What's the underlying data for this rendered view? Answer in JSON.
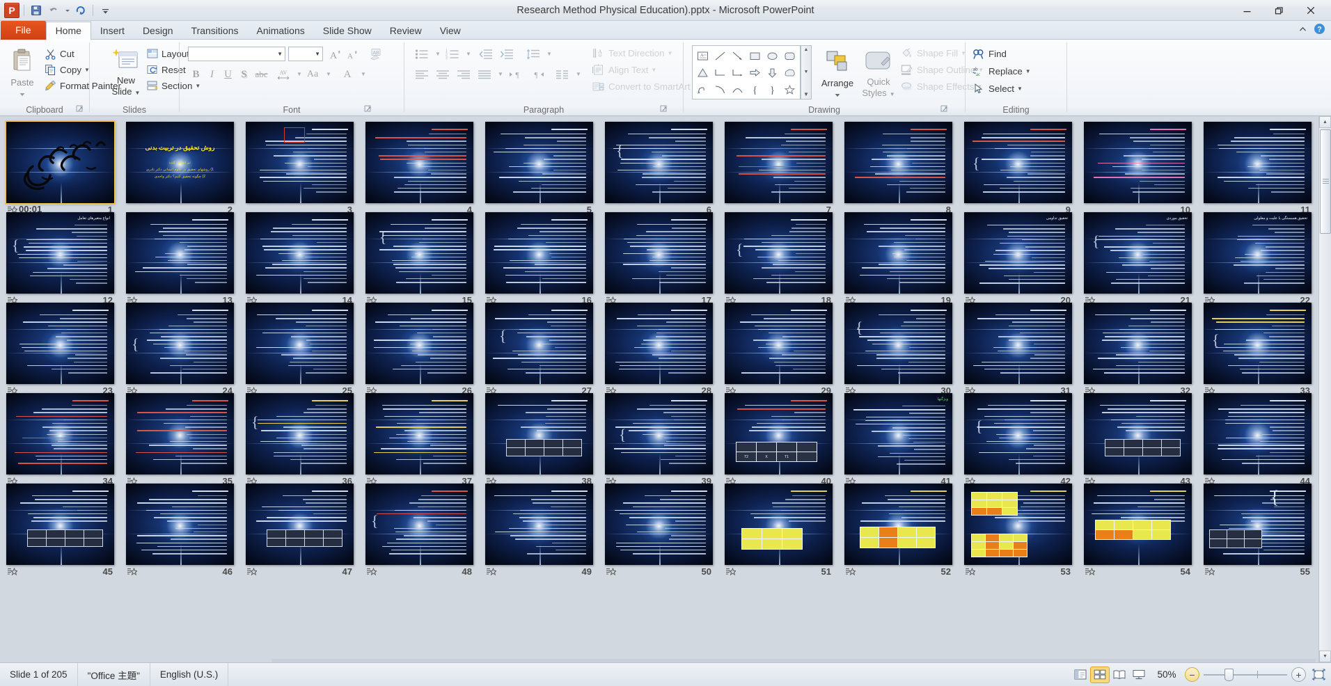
{
  "window": {
    "title": "Research Method Physical Education).pptx  -  Microsoft PowerPoint",
    "minimize_label": "—",
    "restore_label": "❐",
    "close_label": "✕"
  },
  "qat": {
    "app_icon": "powerpoint-icon",
    "app_letter": "P",
    "items": [
      {
        "name": "save-icon",
        "tip": "Save"
      },
      {
        "name": "undo-icon",
        "tip": "Undo"
      },
      {
        "name": "undo-dropdown-icon",
        "tip": "Undo History"
      },
      {
        "name": "redo-icon",
        "tip": "Redo"
      },
      {
        "name": "customize-qat-icon",
        "tip": "Customize Quick Access Toolbar"
      }
    ]
  },
  "tabs": [
    {
      "label": "File",
      "kind": "file"
    },
    {
      "label": "Home",
      "kind": "active"
    },
    {
      "label": "Insert",
      "kind": "normal"
    },
    {
      "label": "Design",
      "kind": "normal"
    },
    {
      "label": "Transitions",
      "kind": "normal"
    },
    {
      "label": "Animations",
      "kind": "normal"
    },
    {
      "label": "Slide Show",
      "kind": "normal"
    },
    {
      "label": "Review",
      "kind": "normal"
    },
    {
      "label": "View",
      "kind": "normal"
    }
  ],
  "help": {
    "minimize_ribbon": "collapse-ribbon-icon",
    "help": "help-icon",
    "help_glyph": "?"
  },
  "ribbon": {
    "groups": [
      {
        "label": "Clipboard"
      },
      {
        "label": "Slides"
      },
      {
        "label": "Font"
      },
      {
        "label": "Paragraph"
      },
      {
        "label": "Drawing"
      },
      {
        "label": "Editing"
      }
    ],
    "clipboard": {
      "paste_label": "Paste",
      "cut_label": "Cut",
      "copy_label": "Copy",
      "format_painter_label": "Format Painter"
    },
    "slides": {
      "new_slide_line1": "New",
      "new_slide_line2": "Slide",
      "layout_label": "Layout",
      "reset_label": "Reset",
      "section_label": "Section"
    },
    "font": {
      "font_name_value": "",
      "font_size_value": "",
      "grow_font": "grow-font-icon",
      "shrink_font": "shrink-font-icon",
      "clear_formatting": "clear-formatting-icon",
      "bold": "B",
      "italic": "I",
      "underline": "U",
      "shadow": "S",
      "strikethrough": "abc",
      "character_spacing": "AV",
      "change_case": "Aa",
      "font_color": "A"
    },
    "paragraph": {
      "bullets": "bullets-icon",
      "numbering": "numbering-icon",
      "decrease_indent": "decrease-indent-icon",
      "increase_indent": "increase-indent-icon",
      "line_spacing": "line-spacing-icon",
      "align_left": "align-left-icon",
      "align_center": "align-center-icon",
      "align_right": "align-right-icon",
      "justify": "justify-icon",
      "ltr": "left-to-right-icon",
      "rtl": "right-to-left-icon",
      "columns": "columns-icon",
      "text_direction_label": "Text Direction",
      "align_text_label": "Align Text",
      "convert_smartart_label": "Convert to SmartArt"
    },
    "drawing": {
      "arrange_label": "Arrange",
      "quick_styles_line1": "Quick",
      "quick_styles_line2": "Styles",
      "shape_fill_label": "Shape Fill",
      "shape_outline_label": "Shape Outline",
      "shape_effects_label": "Shape Effects",
      "shapes": [
        "textbox-shape-icon",
        "line-shape-icon",
        "arrow-shape-icon",
        "rectangle-shape-icon",
        "oval-shape-icon",
        "rounded-rectangle-shape-icon",
        "triangle-shape-icon",
        "elbow-connector-icon",
        "elbow-arrow-connector-icon",
        "right-arrow-shape-icon",
        "down-arrow-shape-icon",
        "cloud-shape-icon",
        "freeform-shape-icon",
        "curve-shape-icon",
        "arc-shape-icon",
        "left-brace-shape-icon",
        "right-brace-shape-icon",
        "star-shape-icon"
      ]
    },
    "editing": {
      "find_label": "Find",
      "replace_label": "Replace",
      "select_label": "Select"
    }
  },
  "sorter": {
    "columns": 11,
    "selected_slide": 1,
    "slides": [
      {
        "n": 1,
        "kind": "bismillah",
        "transition": "00:01",
        "title": "",
        "bullets": []
      },
      {
        "n": 2,
        "kind": "title",
        "transition": "",
        "title": "روش تحقیق در تربیت بدنی",
        "bullets": [
          ":بر اساس کتب",
          "1) روشهای تحقیق در علوم انسانی    دکتر نادری",
          "2)   چگونه تحقیق کنیم؟        دکتر واحدی"
        ]
      },
      {
        "n": 3,
        "kind": "figure-box",
        "transition": "",
        "title": "",
        "bullets": []
      },
      {
        "n": 4,
        "kind": "text-red",
        "transition": "",
        "title": "",
        "bullets": []
      },
      {
        "n": 5,
        "kind": "text",
        "transition": "",
        "title": "",
        "bullets": []
      },
      {
        "n": 6,
        "kind": "text",
        "transition": "",
        "title": "",
        "bullets": []
      },
      {
        "n": 7,
        "kind": "text-red",
        "transition": "",
        "title": "",
        "bullets": []
      },
      {
        "n": 8,
        "kind": "text-red",
        "transition": "",
        "title": "",
        "bullets": []
      },
      {
        "n": 9,
        "kind": "text-red",
        "transition": "",
        "title": "",
        "bullets": []
      },
      {
        "n": 10,
        "kind": "text-pink",
        "transition": "",
        "title": "",
        "bullets": []
      },
      {
        "n": 11,
        "kind": "text",
        "transition": "",
        "title": "",
        "bullets": []
      },
      {
        "n": 12,
        "kind": "text",
        "transition": "icon",
        "title": "انواع متغیرهای تعامل",
        "bullets": []
      },
      {
        "n": 13,
        "kind": "text",
        "transition": "icon",
        "title": "",
        "bullets": []
      },
      {
        "n": 14,
        "kind": "text",
        "transition": "icon",
        "title": "",
        "bullets": []
      },
      {
        "n": 15,
        "kind": "text",
        "transition": "icon",
        "title": "",
        "bullets": []
      },
      {
        "n": 16,
        "kind": "text",
        "transition": "icon",
        "title": "",
        "bullets": []
      },
      {
        "n": 17,
        "kind": "text",
        "transition": "icon",
        "title": "",
        "bullets": []
      },
      {
        "n": 18,
        "kind": "text",
        "transition": "icon",
        "title": "",
        "bullets": []
      },
      {
        "n": 19,
        "kind": "text",
        "transition": "icon",
        "title": "",
        "bullets": []
      },
      {
        "n": 20,
        "kind": "text",
        "transition": "icon",
        "title": "تحقیق تداومی",
        "bullets": []
      },
      {
        "n": 21,
        "kind": "text",
        "transition": "icon",
        "title": "تحقیق موردی",
        "bullets": []
      },
      {
        "n": 22,
        "kind": "text",
        "transition": "icon",
        "title": "تحقیق همبستگی با علیت و معلولی",
        "bullets": []
      },
      {
        "n": 23,
        "kind": "text",
        "transition": "icon",
        "title": "",
        "bullets": []
      },
      {
        "n": 24,
        "kind": "text",
        "transition": "icon",
        "title": "",
        "bullets": []
      },
      {
        "n": 25,
        "kind": "text",
        "transition": "icon",
        "title": "",
        "bullets": []
      },
      {
        "n": 26,
        "kind": "text",
        "transition": "icon",
        "title": "",
        "bullets": []
      },
      {
        "n": 27,
        "kind": "text",
        "transition": "icon",
        "title": "",
        "bullets": []
      },
      {
        "n": 28,
        "kind": "text",
        "transition": "icon",
        "title": "",
        "bullets": []
      },
      {
        "n": 29,
        "kind": "text",
        "transition": "icon",
        "title": "",
        "bullets": []
      },
      {
        "n": 30,
        "kind": "text",
        "transition": "icon",
        "title": "",
        "bullets": []
      },
      {
        "n": 31,
        "kind": "text",
        "transition": "icon",
        "title": "",
        "bullets": []
      },
      {
        "n": 32,
        "kind": "text",
        "transition": "icon",
        "title": "",
        "bullets": []
      },
      {
        "n": 33,
        "kind": "text-yellow",
        "transition": "icon",
        "title": "",
        "bullets": []
      },
      {
        "n": 34,
        "kind": "text-red",
        "transition": "icon",
        "title": "",
        "bullets": []
      },
      {
        "n": 35,
        "kind": "text-red",
        "transition": "icon",
        "title": "",
        "bullets": []
      },
      {
        "n": 36,
        "kind": "text-yellow",
        "transition": "icon",
        "title": "",
        "bullets": []
      },
      {
        "n": 37,
        "kind": "text-yellow",
        "transition": "icon",
        "title": "",
        "bullets": []
      },
      {
        "n": 38,
        "kind": "table-white",
        "transition": "icon",
        "title": "",
        "bullets": []
      },
      {
        "n": 39,
        "kind": "text",
        "transition": "icon",
        "title": "",
        "bullets": []
      },
      {
        "n": 40,
        "kind": "table-t1x",
        "transition": "icon",
        "title": "",
        "bullets": []
      },
      {
        "n": 41,
        "kind": "text-green",
        "transition": "icon",
        "title": "ویژگیها",
        "bullets": []
      },
      {
        "n": 42,
        "kind": "text",
        "transition": "icon",
        "title": "",
        "bullets": []
      },
      {
        "n": 43,
        "kind": "table-white",
        "transition": "icon",
        "title": "",
        "bullets": []
      },
      {
        "n": 44,
        "kind": "text",
        "transition": "icon",
        "title": "",
        "bullets": []
      },
      {
        "n": 45,
        "kind": "table-white",
        "transition": "icon",
        "title": "",
        "bullets": []
      },
      {
        "n": 46,
        "kind": "text",
        "transition": "icon",
        "title": "",
        "bullets": []
      },
      {
        "n": 47,
        "kind": "table-white",
        "transition": "icon",
        "title": "",
        "bullets": []
      },
      {
        "n": 48,
        "kind": "text-red",
        "transition": "icon",
        "title": "",
        "bullets": []
      },
      {
        "n": 49,
        "kind": "text",
        "transition": "icon",
        "title": "",
        "bullets": []
      },
      {
        "n": 50,
        "kind": "text",
        "transition": "icon",
        "title": "",
        "bullets": []
      },
      {
        "n": 51,
        "kind": "table-yellow",
        "transition": "icon",
        "title": "",
        "bullets": []
      },
      {
        "n": 52,
        "kind": "table-orange",
        "transition": "icon",
        "title": "",
        "bullets": []
      },
      {
        "n": 53,
        "kind": "table-dual",
        "transition": "icon",
        "title": "",
        "bullets": []
      },
      {
        "n": 54,
        "kind": "table-wide-orange",
        "transition": "icon",
        "title": "",
        "bullets": []
      },
      {
        "n": 55,
        "kind": "diagram",
        "transition": "icon",
        "title": "",
        "bullets": []
      }
    ]
  },
  "scrollbar": {
    "up_arrow": "scroll-up-icon",
    "down_arrow": "scroll-down-icon",
    "thumb": "scroll-thumb"
  },
  "statusbar": {
    "slide_counter": "Slide 1 of 205",
    "theme": "\"Office 主題\"",
    "language": "English (U.S.)",
    "zoom_level": "50%",
    "views": [
      {
        "name": "normal-view-button",
        "active": false
      },
      {
        "name": "slide-sorter-view-button",
        "active": true
      },
      {
        "name": "reading-view-button",
        "active": false
      },
      {
        "name": "slide-show-button",
        "active": false
      }
    ],
    "zoom_out": "−",
    "zoom_in": "+",
    "fit_to_window": "fit-slide-to-window-icon"
  }
}
